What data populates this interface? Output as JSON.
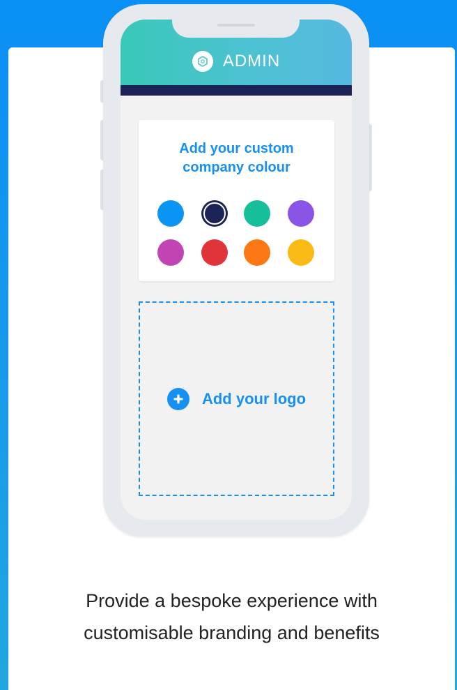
{
  "header": {
    "title": "ADMIN",
    "logo_icon": "hexagon-logo-icon"
  },
  "color_picker": {
    "title_line1": "Add your custom",
    "title_line2": "company colour",
    "selected": "#1c2357",
    "swatches": [
      {
        "name": "blue",
        "color": "#0a95f5"
      },
      {
        "name": "navy",
        "color": "#1c2357"
      },
      {
        "name": "teal",
        "color": "#14bf9a"
      },
      {
        "name": "purple",
        "color": "#8a55e6"
      },
      {
        "name": "magenta",
        "color": "#c044b4"
      },
      {
        "name": "red",
        "color": "#e0343b"
      },
      {
        "name": "orange",
        "color": "#fb7814"
      },
      {
        "name": "yellow",
        "color": "#fbbb16"
      }
    ]
  },
  "logo_upload": {
    "label": "Add your logo",
    "icon": "plus-circle-icon"
  },
  "caption": {
    "line1": "Provide a bespoke experience with",
    "line2": "customisable branding and benefits"
  },
  "colors": {
    "accent": "#1690f2",
    "header_bar": "#1c2357"
  }
}
